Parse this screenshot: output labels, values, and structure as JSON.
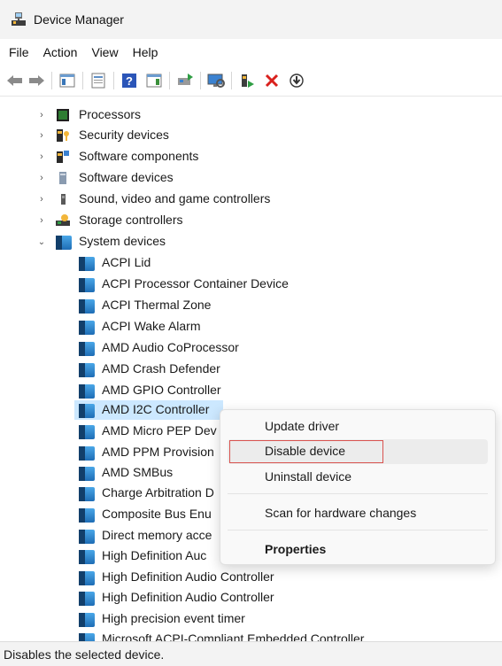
{
  "window": {
    "title": "Device Manager"
  },
  "menu": [
    "File",
    "Action",
    "View",
    "Help"
  ],
  "toolbar_icons": [
    "back-arrow-icon",
    "forward-arrow-icon",
    "show-hide-console-tree-icon",
    "properties-icon",
    "help-icon",
    "action-pane-icon",
    "update-driver-icon",
    "scan-hardware-icon",
    "add-legacy-hardware-icon",
    "uninstall-device-icon",
    "download-driver-icon"
  ],
  "tree": {
    "categories": [
      {
        "label": "Processors",
        "icon": "processor-icon",
        "expanded": false
      },
      {
        "label": "Security devices",
        "icon": "security-devices-icon",
        "expanded": false
      },
      {
        "label": "Software components",
        "icon": "software-components-icon",
        "expanded": false
      },
      {
        "label": "Software devices",
        "icon": "software-devices-icon",
        "expanded": false
      },
      {
        "label": "Sound, video and game controllers",
        "icon": "speaker-icon",
        "expanded": false
      },
      {
        "label": "Storage controllers",
        "icon": "storage-controller-icon",
        "expanded": false
      },
      {
        "label": "System devices",
        "icon": "system-devices-icon",
        "expanded": true
      }
    ],
    "system_devices": [
      "ACPI Lid",
      "ACPI Processor Container Device",
      "ACPI Thermal Zone",
      "ACPI Wake Alarm",
      "AMD Audio CoProcessor",
      "AMD Crash Defender",
      "AMD GPIO Controller",
      "AMD I2C Controller",
      "AMD Micro PEP Dev",
      "AMD PPM Provision",
      "AMD SMBus",
      "Charge Arbitration D",
      "Composite Bus Enu",
      "Direct memory acce",
      "High Definition Auc",
      "High Definition Audio Controller",
      "High Definition Audio Controller",
      "High precision event timer",
      "Microsoft ACPI-Compliant Embedded Controller"
    ],
    "selected": "AMD I2C Controller"
  },
  "context_menu": {
    "items": [
      "Update driver",
      "Disable device",
      "Uninstall device",
      "Scan for hardware changes",
      "Properties"
    ],
    "highlighted": "Disable device"
  },
  "status": {
    "text": "Disables the selected device."
  }
}
